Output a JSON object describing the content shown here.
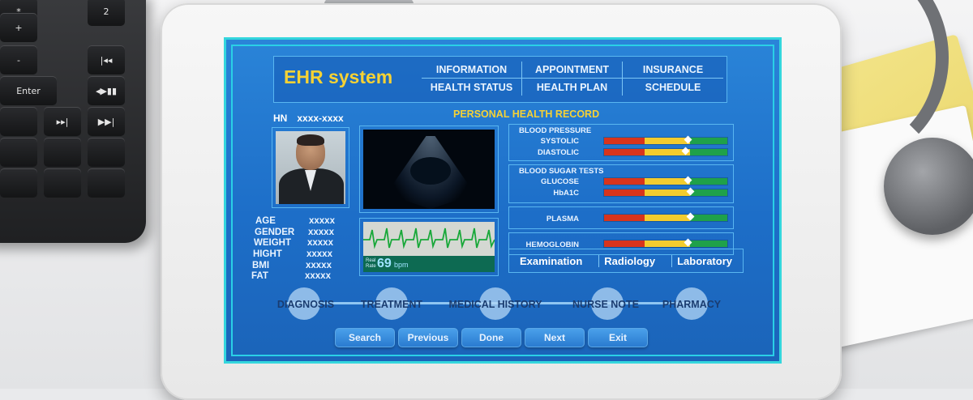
{
  "app": {
    "title": "EHR system"
  },
  "menu": [
    {
      "label": "INFORMATION"
    },
    {
      "label": "APPOINTMENT"
    },
    {
      "label": "INSURANCE"
    },
    {
      "label": "HEALTH STATUS"
    },
    {
      "label": "HEALTH PLAN"
    },
    {
      "label": "SCHEDULE"
    }
  ],
  "patient": {
    "hn_label": "HN",
    "hn_value": "xxxx-xxxx"
  },
  "record_title": "PERSONAL HEALTH RECORD",
  "vitals": [
    {
      "label": "AGE",
      "value": "xxxxx"
    },
    {
      "label": "GENDER",
      "value": "xxxxx"
    },
    {
      "label": "WEIGHT",
      "value": "xxxxx"
    },
    {
      "label": "HIGHT",
      "value": "xxxxx"
    },
    {
      "label": "BMI",
      "value": "xxxxx"
    },
    {
      "label": "FAT",
      "value": "xxxxx"
    }
  ],
  "ecg": {
    "rate_label_1": "Real",
    "rate_label_2": "Rate",
    "value": "69",
    "unit": "bpm"
  },
  "labs": {
    "blood_pressure": {
      "title": "BLOOD PRESSURE",
      "items": [
        {
          "label": "SYSTOLIC",
          "level": 0.68
        },
        {
          "label": "DIASTOLIC",
          "level": 0.66
        }
      ]
    },
    "blood_sugar": {
      "title": "BLOOD SUGAR TESTS",
      "items": [
        {
          "label": "GLUCOSE",
          "level": 0.68
        },
        {
          "label": "HbA1C",
          "level": 0.7
        }
      ]
    },
    "plasma": {
      "label": "PLASMA",
      "level": 0.7
    },
    "hemoglobin": {
      "label": "HEMOGLOBIN",
      "level": 0.68
    }
  },
  "tabs": [
    {
      "label": "Examination"
    },
    {
      "label": "Radiology"
    },
    {
      "label": "Laboratory"
    }
  ],
  "timeline": [
    {
      "label": "DIAGNOSIS"
    },
    {
      "label": "TREATMENT"
    },
    {
      "label": "MEDICAL HISTORY"
    },
    {
      "label": "NURSE NOTE"
    },
    {
      "label": "PHARMACY"
    }
  ],
  "buttons": [
    {
      "label": "Search"
    },
    {
      "label": "Previous"
    },
    {
      "label": "Done"
    },
    {
      "label": "Next"
    },
    {
      "label": "Exit"
    }
  ],
  "keyboard": {
    "keys": [
      "*",
      "2",
      "+",
      "-",
      "Enter",
      "|◂◂",
      "◂▶▮▮",
      "▶▶|",
      "▸▸|"
    ]
  },
  "colors": {
    "accent_yellow": "#f6d234",
    "screen_blue": "#1d6ec8",
    "frame_cyan": "#34d6dd"
  }
}
